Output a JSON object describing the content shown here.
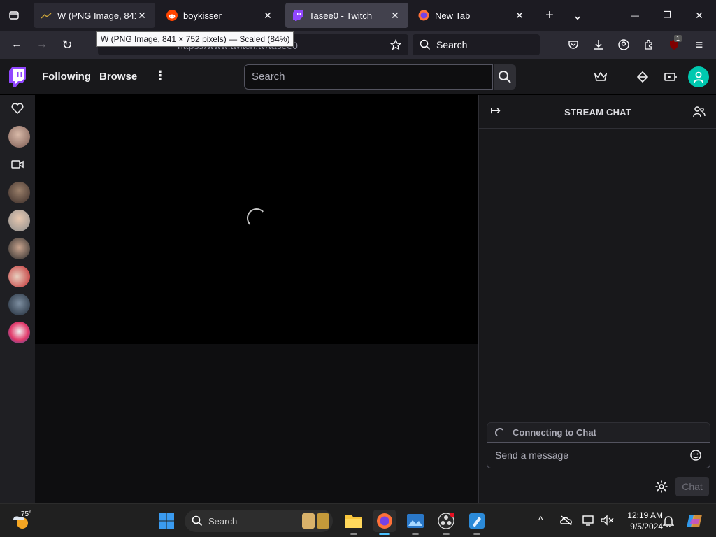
{
  "browser": {
    "tabs": [
      {
        "title": "W (PNG Image, 841 ×",
        "active": false
      },
      {
        "title": "boykisser",
        "active": false
      },
      {
        "title": "Tasee0 - Twitch",
        "active": true
      },
      {
        "title": "New Tab",
        "active": false
      }
    ],
    "tooltip": "W (PNG Image, 841 × 752 pixels) — Scaled (84%)",
    "url": "https://www.twitch.tv/tasee0",
    "search_placeholder": "Search",
    "extension_badge": "1",
    "close_glyph": "✕",
    "new_tab_glyph": "+",
    "back_glyph": "←",
    "forward_glyph": "→",
    "reload_glyph": "↻",
    "list_tabs_glyph": "⌄",
    "minimize_glyph": "—",
    "restore_glyph": "❐",
    "menu_glyph": "≡"
  },
  "twitch": {
    "nav": {
      "following": "Following",
      "browse": "Browse",
      "search_placeholder": "Search",
      "more_glyph": "⋮"
    },
    "chat": {
      "title": "STREAM CHAT",
      "connecting": "Connecting to Chat",
      "input_placeholder": "Send a message",
      "send_label": "Chat",
      "collapse_glyph": "↦"
    },
    "colors": {
      "brand": "#9147ff",
      "avatar_icon": "#00c8af"
    }
  },
  "taskbar": {
    "weather_temp": "75°",
    "search_placeholder": "Search",
    "time": "12:19 AM",
    "date": "9/5/2024",
    "tray_chevron": "^"
  }
}
